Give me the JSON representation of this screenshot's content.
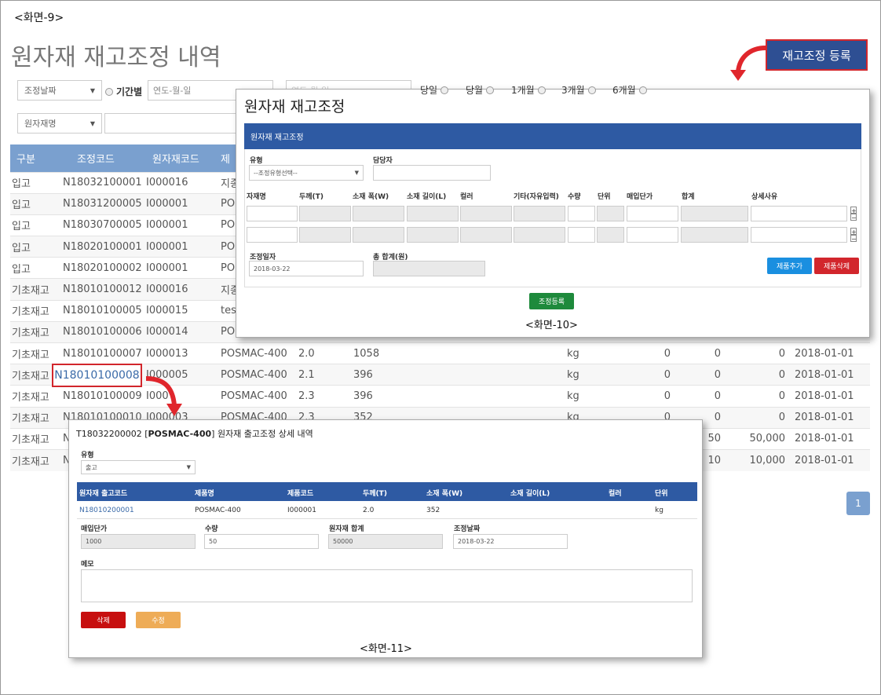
{
  "labels": {
    "screen9": "<화면-9>",
    "screen10": "<화면-10>",
    "screen11": "<화면-11>"
  },
  "page": {
    "title": "원자재 재고조정 내역",
    "register_button": "재고조정 등록"
  },
  "filters": {
    "date_type_select": "조정날짜",
    "period_label": "기간별",
    "date_placeholder": "연도-월-일",
    "date2_partial": "연도-월-일",
    "period_options": [
      "당일",
      "당월",
      "1개월",
      "3개월",
      "6개월"
    ],
    "material_select": "원자재명"
  },
  "table": {
    "headers": [
      "구분",
      "조정코드",
      "원자재코드",
      "제"
    ],
    "rows": [
      {
        "type": "입고",
        "code": "N18032100001",
        "mat": "I000016",
        "name": "지종",
        "t": "",
        "w": "",
        "unit": "",
        "price": "",
        "qty": "",
        "sum": "",
        "date": ""
      },
      {
        "type": "입고",
        "code": "N18031200005",
        "mat": "I000001",
        "name": "PO",
        "t": "",
        "w": "",
        "unit": "",
        "price": "",
        "qty": "",
        "sum": "",
        "date": ""
      },
      {
        "type": "입고",
        "code": "N18030700005",
        "mat": "I000001",
        "name": "PO",
        "t": "",
        "w": "",
        "unit": "",
        "price": "",
        "qty": "",
        "sum": "",
        "date": ""
      },
      {
        "type": "입고",
        "code": "N18020100001",
        "mat": "I000001",
        "name": "PO",
        "t": "",
        "w": "",
        "unit": "",
        "price": "",
        "qty": "",
        "sum": "",
        "date": ""
      },
      {
        "type": "입고",
        "code": "N18020100002",
        "mat": "I000001",
        "name": "PO",
        "t": "",
        "w": "",
        "unit": "",
        "price": "",
        "qty": "",
        "sum": "",
        "date": ""
      },
      {
        "type": "기초재고",
        "code": "N18010100012",
        "mat": "I000016",
        "name": "지종",
        "t": "",
        "w": "",
        "unit": "",
        "price": "",
        "qty": "",
        "sum": "",
        "date": ""
      },
      {
        "type": "기초재고",
        "code": "N18010100005",
        "mat": "I000015",
        "name": "tes",
        "t": "",
        "w": "",
        "unit": "",
        "price": "",
        "qty": "",
        "sum": "",
        "date": ""
      },
      {
        "type": "기초재고",
        "code": "N18010100006",
        "mat": "I000014",
        "name": "PO",
        "t": "",
        "w": "",
        "unit": "",
        "price": "",
        "qty": "",
        "sum": "",
        "date": ""
      },
      {
        "type": "기초재고",
        "code": "N18010100007",
        "mat": "I000013",
        "name": "POSMAC-400",
        "t": "2.0",
        "w": "1058",
        "unit": "kg",
        "price": "0",
        "qty": "0",
        "sum": "0",
        "date": "2018-01-01"
      },
      {
        "type": "기초재고",
        "code": "N18010100008",
        "mat": "I000005",
        "name": "POSMAC-400",
        "t": "2.1",
        "w": "396",
        "unit": "kg",
        "price": "0",
        "qty": "0",
        "sum": "0",
        "date": "2018-01-01"
      },
      {
        "type": "기초재고",
        "code": "N18010100009",
        "mat": "I000",
        "name": "POSMAC-400",
        "t": "2.3",
        "w": "396",
        "unit": "kg",
        "price": "0",
        "qty": "0",
        "sum": "0",
        "date": "2018-01-01"
      },
      {
        "type": "기초재고",
        "code": "N18010100010",
        "mat": "I000003",
        "name": "POSMAC-400",
        "t": "2.3",
        "w": "352",
        "unit": "kg",
        "price": "0",
        "qty": "0",
        "sum": "0",
        "date": "2018-01-01"
      },
      {
        "type": "기초재고",
        "code": "N",
        "mat": "",
        "name": "",
        "t": "",
        "w": "",
        "unit": "",
        "price": "",
        "qty": "50",
        "sum": "50,000",
        "date": "2018-01-01"
      },
      {
        "type": "기초재고",
        "code": "N",
        "mat": "",
        "name": "",
        "t": "",
        "w": "",
        "unit": "",
        "price": "",
        "qty": "10",
        "sum": "10,000",
        "date": "2018-01-01"
      }
    ],
    "highlighted_code": "N18010100008"
  },
  "pagination": {
    "current": "1"
  },
  "popup10": {
    "title": "원자재 재고조정",
    "bar": "원자재 재고조정",
    "type_label": "유형",
    "type_select": "--조정유형선택--",
    "manager_label": "담당자",
    "columns": [
      "자재명",
      "두께(T)",
      "소재 폭(W)",
      "소재 길이(L)",
      "컬러",
      "기타(자유입력)",
      "수량",
      "단위",
      "매입단가",
      "합계",
      "상세사유"
    ],
    "date_label": "조정일자",
    "date_value": "2018-03-22",
    "total_label": "총 합계(원)",
    "add_button": "제품추가",
    "delete_button": "제품삭제",
    "submit_button": "조정등록",
    "plus": "+",
    "minus": "−"
  },
  "popup11": {
    "title_code": "T18032200002 [",
    "title_name": "POSMAC-400",
    "title_rest": "] 원자재 출고조정 상세 내역",
    "type_label": "유형",
    "type_value": "출고",
    "headers": [
      "원자재 출고코드",
      "제품명",
      "제품코드",
      "두께(T)",
      "소재 폭(W)",
      "소재 길이(L)",
      "컬러",
      "단위"
    ],
    "row": [
      "N18010200001",
      "POSMAC-400",
      "I000001",
      "2.0",
      "352",
      "",
      "",
      "kg"
    ],
    "price_label": "매입단가",
    "price_value": "1000",
    "qty_label": "수량",
    "qty_value": "50",
    "sum_label": "원자재 합계",
    "sum_value": "50000",
    "date_label": "조정날짜",
    "date_value": "2018-03-22",
    "memo_label": "메모",
    "delete_button": "삭제",
    "edit_button": "수정"
  },
  "colors": {
    "brand_blue": "#2e4f93",
    "header_blue": "#7aa0cf",
    "red": "#d2262c",
    "green": "#1e8a3c",
    "sky": "#1a8fe0",
    "orange": "#eeac57"
  }
}
